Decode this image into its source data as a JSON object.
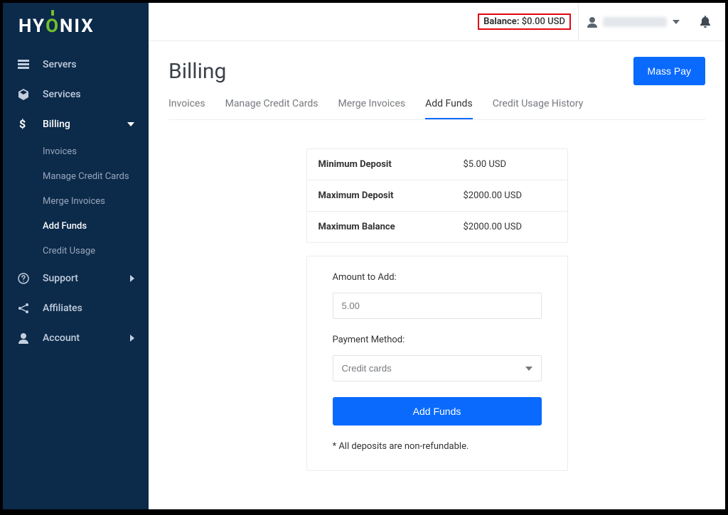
{
  "brand": {
    "pre": "HY",
    "post": "NIX"
  },
  "sidebar": {
    "items": [
      {
        "icon": "servers",
        "label": "Servers"
      },
      {
        "icon": "cube",
        "label": "Services"
      },
      {
        "icon": "dollar",
        "label": "Billing",
        "active": true,
        "expanded": true,
        "sub": [
          {
            "label": "Invoices"
          },
          {
            "label": "Manage Credit Cards"
          },
          {
            "label": "Merge Invoices"
          },
          {
            "label": "Add Funds",
            "active": true
          },
          {
            "label": "Credit Usage"
          }
        ]
      },
      {
        "icon": "help",
        "label": "Support",
        "chev": true
      },
      {
        "icon": "share",
        "label": "Affiliates"
      },
      {
        "icon": "user",
        "label": "Account",
        "chev": true
      }
    ]
  },
  "header": {
    "balance_label": "Balance:",
    "balance_value": "$0.00 USD"
  },
  "page": {
    "title": "Billing",
    "mass_pay": "Mass Pay",
    "tabs": [
      {
        "label": "Invoices"
      },
      {
        "label": "Manage Credit Cards"
      },
      {
        "label": "Merge Invoices"
      },
      {
        "label": "Add Funds",
        "active": true
      },
      {
        "label": "Credit Usage History"
      }
    ],
    "limits": [
      {
        "k": "Minimum Deposit",
        "v": "$5.00 USD"
      },
      {
        "k": "Maximum Deposit",
        "v": "$2000.00 USD"
      },
      {
        "k": "Maximum Balance",
        "v": "$2000.00 USD"
      }
    ],
    "form": {
      "amount_label": "Amount to Add:",
      "amount_value": "5.00",
      "method_label": "Payment Method:",
      "method_selected": "Credit cards",
      "submit": "Add Funds",
      "note": "* All deposits are non-refundable."
    }
  }
}
